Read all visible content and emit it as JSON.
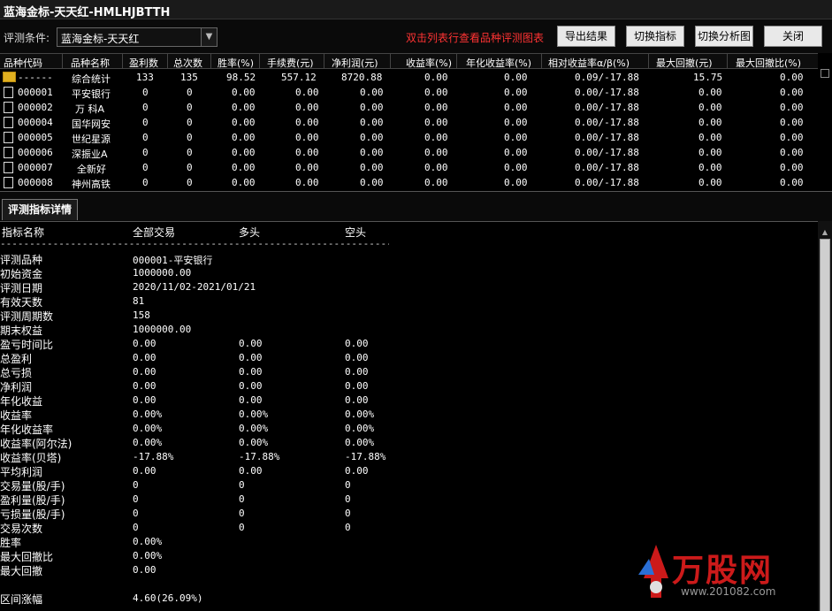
{
  "window": {
    "title": "蓝海金标-天天红-HMLHJBTTH"
  },
  "toolbar": {
    "condition_label": "评测条件:",
    "condition_value": "蓝海金标-天天红",
    "hint": "双击列表行查看品种评测图表",
    "export_label": "导出结果",
    "switch_indicator_label": "切换指标",
    "switch_chart_label": "切换分析图",
    "close_label": "关闭"
  },
  "table": {
    "columns": [
      "品种代码",
      "品种名称",
      "盈利数",
      "总次数",
      "胜率(%)",
      "手续费(元)",
      "净利润(元)",
      "收益率(%)",
      "年化收益率(%)",
      "相对收益率α/β(%)",
      "最大回撤(元)",
      "最大回撤比(%)"
    ],
    "rows": [
      [
        "------",
        "综合统计",
        "133",
        "135",
        "98.52",
        "557.12",
        "8720.88",
        "0.00",
        "0.00",
        "0.09/-17.88",
        "15.75",
        "0.00"
      ],
      [
        "000001",
        "平安银行",
        "0",
        "0",
        "0.00",
        "0.00",
        "0.00",
        "0.00",
        "0.00",
        "0.00/-17.88",
        "0.00",
        "0.00"
      ],
      [
        "000002",
        "万 科A",
        "0",
        "0",
        "0.00",
        "0.00",
        "0.00",
        "0.00",
        "0.00",
        "0.00/-17.88",
        "0.00",
        "0.00"
      ],
      [
        "000004",
        "国华网安",
        "0",
        "0",
        "0.00",
        "0.00",
        "0.00",
        "0.00",
        "0.00",
        "0.00/-17.88",
        "0.00",
        "0.00"
      ],
      [
        "000005",
        "世纪星源",
        "0",
        "0",
        "0.00",
        "0.00",
        "0.00",
        "0.00",
        "0.00",
        "0.00/-17.88",
        "0.00",
        "0.00"
      ],
      [
        "000006",
        "深振业A",
        "0",
        "0",
        "0.00",
        "0.00",
        "0.00",
        "0.00",
        "0.00",
        "0.00/-17.88",
        "0.00",
        "0.00"
      ],
      [
        "000007",
        "全新好",
        "0",
        "0",
        "0.00",
        "0.00",
        "0.00",
        "0.00",
        "0.00",
        "0.00/-17.88",
        "0.00",
        "0.00"
      ],
      [
        "000008",
        "神州高铁",
        "0",
        "0",
        "0.00",
        "0.00",
        "0.00",
        "0.00",
        "0.00",
        "0.00/-17.88",
        "0.00",
        "0.00"
      ]
    ]
  },
  "tab": {
    "label": "评测指标详情"
  },
  "detail": {
    "headers": [
      "指标名称",
      "全部交易",
      "多头",
      "空头"
    ],
    "separator": "------------------------------------------------------------------------",
    "rows": [
      [
        "评测品种",
        "000001-平安银行",
        "",
        ""
      ],
      [
        "初始资金",
        "1000000.00",
        "",
        ""
      ],
      [
        "评测日期",
        "2020/11/02-2021/01/21",
        "",
        ""
      ],
      [
        "有效天数",
        "81",
        "",
        ""
      ],
      [
        "评测周期数",
        "158",
        "",
        ""
      ],
      [
        "期末权益",
        "1000000.00",
        "",
        ""
      ],
      [
        "盈亏时间比",
        "0.00",
        "0.00",
        "0.00"
      ],
      [
        "总盈利",
        "0.00",
        "0.00",
        "0.00"
      ],
      [
        "总亏损",
        "0.00",
        "0.00",
        "0.00"
      ],
      [
        "净利润",
        "0.00",
        "0.00",
        "0.00"
      ],
      [
        "年化收益",
        "0.00",
        "0.00",
        "0.00"
      ],
      [
        "收益率",
        "0.00%",
        "0.00%",
        "0.00%"
      ],
      [
        "年化收益率",
        "0.00%",
        "0.00%",
        "0.00%"
      ],
      [
        "收益率(阿尔法)",
        "0.00%",
        "0.00%",
        "0.00%"
      ],
      [
        "收益率(贝塔)",
        "-17.88%",
        "-17.88%",
        "-17.88%"
      ],
      [
        "平均利润",
        "0.00",
        "0.00",
        "0.00"
      ],
      [
        "交易量(股/手)",
        "0",
        "0",
        "0"
      ],
      [
        "盈利量(股/手)",
        "0",
        "0",
        "0"
      ],
      [
        "亏损量(股/手)",
        "0",
        "0",
        "0"
      ],
      [
        "交易次数",
        "0",
        "0",
        "0"
      ],
      [
        "胜率",
        "0.00%",
        "",
        ""
      ],
      [
        "最大回撤比",
        "0.00%",
        "",
        ""
      ],
      [
        "最大回撤",
        "0.00",
        "",
        ""
      ]
    ],
    "range_label": "区间涨幅",
    "range_value": "4.60(26.09%)"
  },
  "watermark": {
    "text": "万股网",
    "url": "www.201082.com"
  },
  "colors": {
    "background": "#000000",
    "hint": "#ff3333",
    "watermark": "#cc1a1a"
  }
}
